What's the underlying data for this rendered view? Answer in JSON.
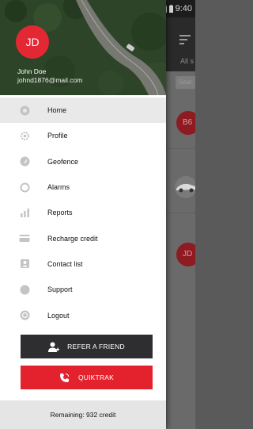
{
  "status_bar": {
    "time": "9:40"
  },
  "background_app": {
    "tab_label": "All s",
    "search_placeholder": "Sear",
    "avatars": [
      "B6",
      "JD"
    ]
  },
  "drawer": {
    "header": {
      "avatar_initials": "JD",
      "user_name": "John Doe",
      "user_email": "johnd1876@mail.com"
    },
    "menu": [
      {
        "label": "Home",
        "icon": "home-icon",
        "active": true
      },
      {
        "label": "Profile",
        "icon": "profile-icon",
        "active": false
      },
      {
        "label": "Geofence",
        "icon": "geofence-icon",
        "active": false
      },
      {
        "label": "Alarms",
        "icon": "alarm-icon",
        "active": false
      },
      {
        "label": "Reports",
        "icon": "reports-icon",
        "active": false
      },
      {
        "label": "Recharge credit",
        "icon": "recharge-icon",
        "active": false
      },
      {
        "label": "Contact list",
        "icon": "contacts-icon",
        "active": false
      },
      {
        "label": "Support",
        "icon": "support-icon",
        "active": false
      },
      {
        "label": "Logout",
        "icon": "logout-icon",
        "active": false
      }
    ],
    "refer_button": {
      "label": "REFER A FRIEND",
      "icon": "refer-user-icon"
    },
    "quiktrak_button": {
      "label": "QUIKTRAK",
      "icon": "phone-icon"
    },
    "footer": {
      "remaining": "Remaining: 932 credit"
    }
  },
  "colors": {
    "accent_red": "#e4222d",
    "dark_button": "#2e2e30",
    "active_item": "#e9e9e9",
    "icon_grey": "#c4c4c4"
  }
}
